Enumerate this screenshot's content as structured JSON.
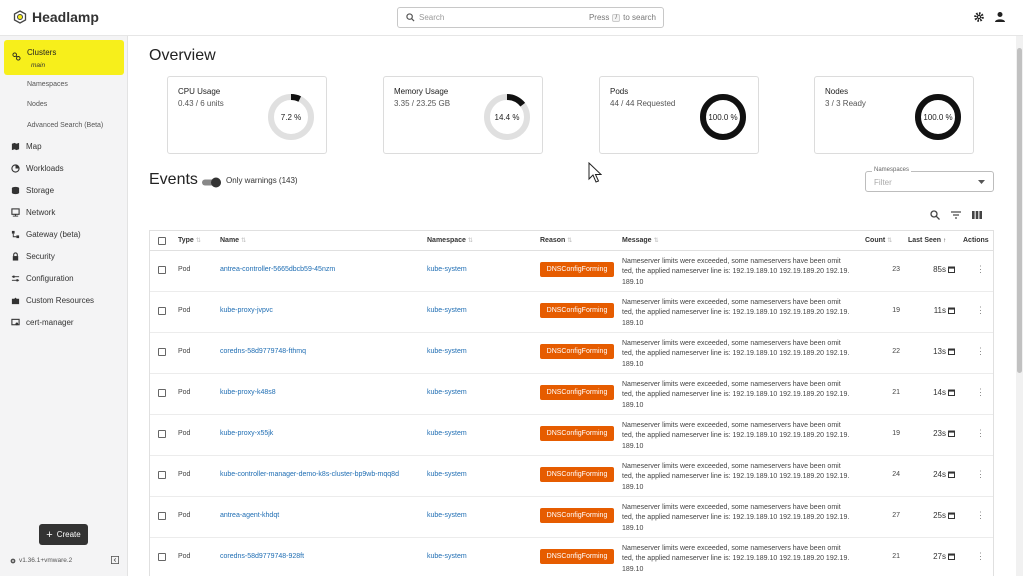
{
  "app": {
    "name": "Headlamp"
  },
  "search": {
    "placeholder": "Search",
    "hint_press": "Press",
    "hint_key": "/",
    "hint_after": "to search"
  },
  "sidebar": {
    "cluster": {
      "label": "Clusters",
      "sub": "main"
    },
    "subitems": [
      "Namespaces",
      "Nodes",
      "Advanced Search (Beta)"
    ],
    "items": [
      {
        "label": "Map",
        "icon": "map-icon"
      },
      {
        "label": "Workloads",
        "icon": "workloads-icon"
      },
      {
        "label": "Storage",
        "icon": "storage-icon"
      },
      {
        "label": "Network",
        "icon": "network-icon"
      },
      {
        "label": "Gateway (beta)",
        "icon": "gateway-icon"
      },
      {
        "label": "Security",
        "icon": "lock-icon"
      },
      {
        "label": "Configuration",
        "icon": "sliders-icon"
      },
      {
        "label": "Custom Resources",
        "icon": "puzzle-icon"
      },
      {
        "label": "cert-manager",
        "icon": "certificate-icon"
      }
    ],
    "create_label": "Create",
    "version": "v1.36.1+vmware.2"
  },
  "overview": {
    "title": "Overview",
    "cards": [
      {
        "title": "CPU Usage",
        "value": "0.43 / 6 units",
        "percent_label": "7.2 %",
        "percent": 7.2
      },
      {
        "title": "Memory Usage",
        "value": "3.35 / 23.25 GB",
        "percent_label": "14.4 %",
        "percent": 14.4
      },
      {
        "title": "Pods",
        "value": "44 / 44 Requested",
        "percent_label": "100.0 %",
        "percent": 100
      },
      {
        "title": "Nodes",
        "value": "3 / 3 Ready",
        "percent_label": "100.0 %",
        "percent": 100
      }
    ]
  },
  "events": {
    "title": "Events",
    "toggle_label": "Only warnings (143)",
    "namespaces_legend": "Namespaces",
    "namespaces_placeholder": "Filter",
    "columns": [
      "Type",
      "Name",
      "Namespace",
      "Reason",
      "Message",
      "Count",
      "Last Seen",
      "Actions"
    ],
    "message": "Nameserver limits were exceeded, some nameservers have been omitted, the applied nameserver line is: 192.19.189.10 192.19.189.20 192.19.189.10",
    "message_lines": [
      "Nameserver limits were exceeded, some nameservers have been omit",
      "ted, the applied nameserver line is: 192.19.189.10 192.19.189.20 192.19.",
      "189.10"
    ],
    "rows": [
      {
        "type": "Pod",
        "name": "antrea-controller-5665dbcb59-45nzm",
        "namespace": "kube-system",
        "reason": "DNSConfigForming",
        "count": "23",
        "last_seen": "85s"
      },
      {
        "type": "Pod",
        "name": "kube-proxy-jvpvc",
        "namespace": "kube-system",
        "reason": "DNSConfigForming",
        "count": "19",
        "last_seen": "11s"
      },
      {
        "type": "Pod",
        "name": "coredns-58d9779748-fthmq",
        "namespace": "kube-system",
        "reason": "DNSConfigForming",
        "count": "22",
        "last_seen": "13s"
      },
      {
        "type": "Pod",
        "name": "kube-proxy-k48s8",
        "namespace": "kube-system",
        "reason": "DNSConfigForming",
        "count": "21",
        "last_seen": "14s"
      },
      {
        "type": "Pod",
        "name": "kube-proxy-x55jk",
        "namespace": "kube-system",
        "reason": "DNSConfigForming",
        "count": "19",
        "last_seen": "23s"
      },
      {
        "type": "Pod",
        "name": "kube-controller-manager-demo-k8s-cluster-bp9wb-mqq8d",
        "namespace": "kube-system",
        "reason": "DNSConfigForming",
        "count": "24",
        "last_seen": "24s"
      },
      {
        "type": "Pod",
        "name": "antrea-agent-khdqt",
        "namespace": "kube-system",
        "reason": "DNSConfigForming",
        "count": "27",
        "last_seen": "25s"
      },
      {
        "type": "Pod",
        "name": "coredns-58d9779748-928ft",
        "namespace": "kube-system",
        "reason": "DNSConfigForming",
        "count": "21",
        "last_seen": "27s"
      }
    ]
  },
  "colors": {
    "accent": "#f7ef1b",
    "reason_badge": "#e65c00",
    "link": "#1e6db3",
    "donut_fill": "#111111",
    "donut_track": "#e0e0e0"
  }
}
